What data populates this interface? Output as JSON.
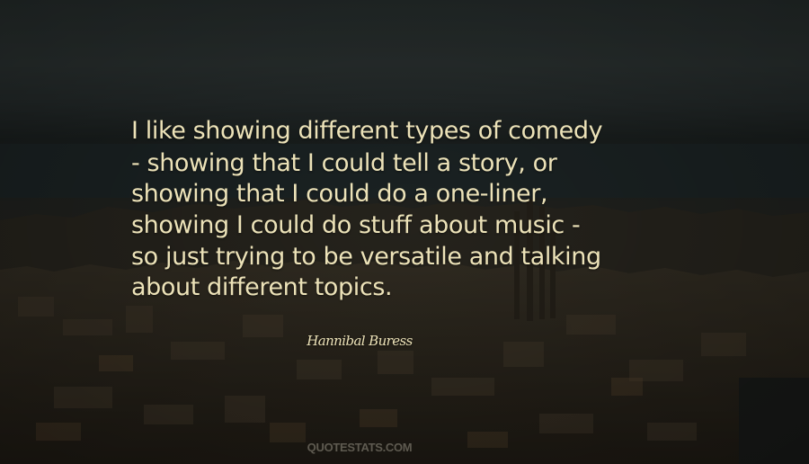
{
  "quote": {
    "lines": [
      "I like showing different types of comedy",
      "- showing that I could tell a story, or",
      "showing that I could do a one-liner,",
      "showing I could do stuff about music -",
      "so just trying to be versatile and talking",
      "about different topics."
    ]
  },
  "author": "Hannibal Buress",
  "watermark": "QUOTESTATS.COM",
  "colors": {
    "text": "#ece2b8",
    "sky": "#313938",
    "city": "#2a271f"
  }
}
